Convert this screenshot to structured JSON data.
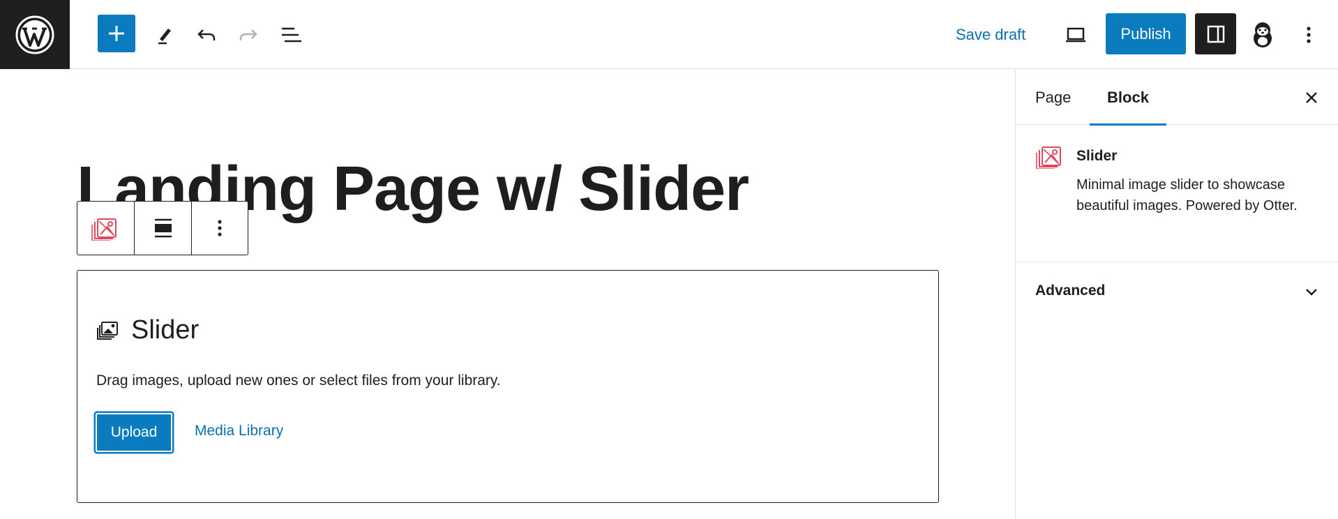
{
  "topbar": {
    "save_draft_label": "Save draft",
    "publish_label": "Publish",
    "icons": [
      "wordpress-logo",
      "plus-icon",
      "pencil-icon",
      "undo-icon",
      "redo-icon",
      "list-view-icon",
      "desktop-preview-icon",
      "sidebar-toggle-icon",
      "otter-icon",
      "more-vertical-icon"
    ]
  },
  "editor": {
    "page_title": "Landing Page w/ Slider",
    "block_toolbar": {
      "icons": [
        "slider-block-icon",
        "align-icon",
        "more-options-icon"
      ]
    },
    "slider_placeholder": {
      "title": "Slider",
      "instructions": "Drag images, upload new ones or select files from your library.",
      "upload_label": "Upload",
      "media_library_label": "Media Library"
    }
  },
  "sidebar": {
    "tabs": [
      {
        "label": "Page"
      },
      {
        "label": "Block",
        "active": true
      }
    ],
    "block": {
      "title": "Slider",
      "description": "Minimal image slider to showcase beautiful images. Powered by Otter."
    },
    "panels": [
      {
        "label": "Advanced",
        "expanded": false
      }
    ]
  },
  "colors": {
    "accent": "#0a7bbf",
    "dark": "#1e1e1e",
    "slider_icon": "#e0475e"
  }
}
